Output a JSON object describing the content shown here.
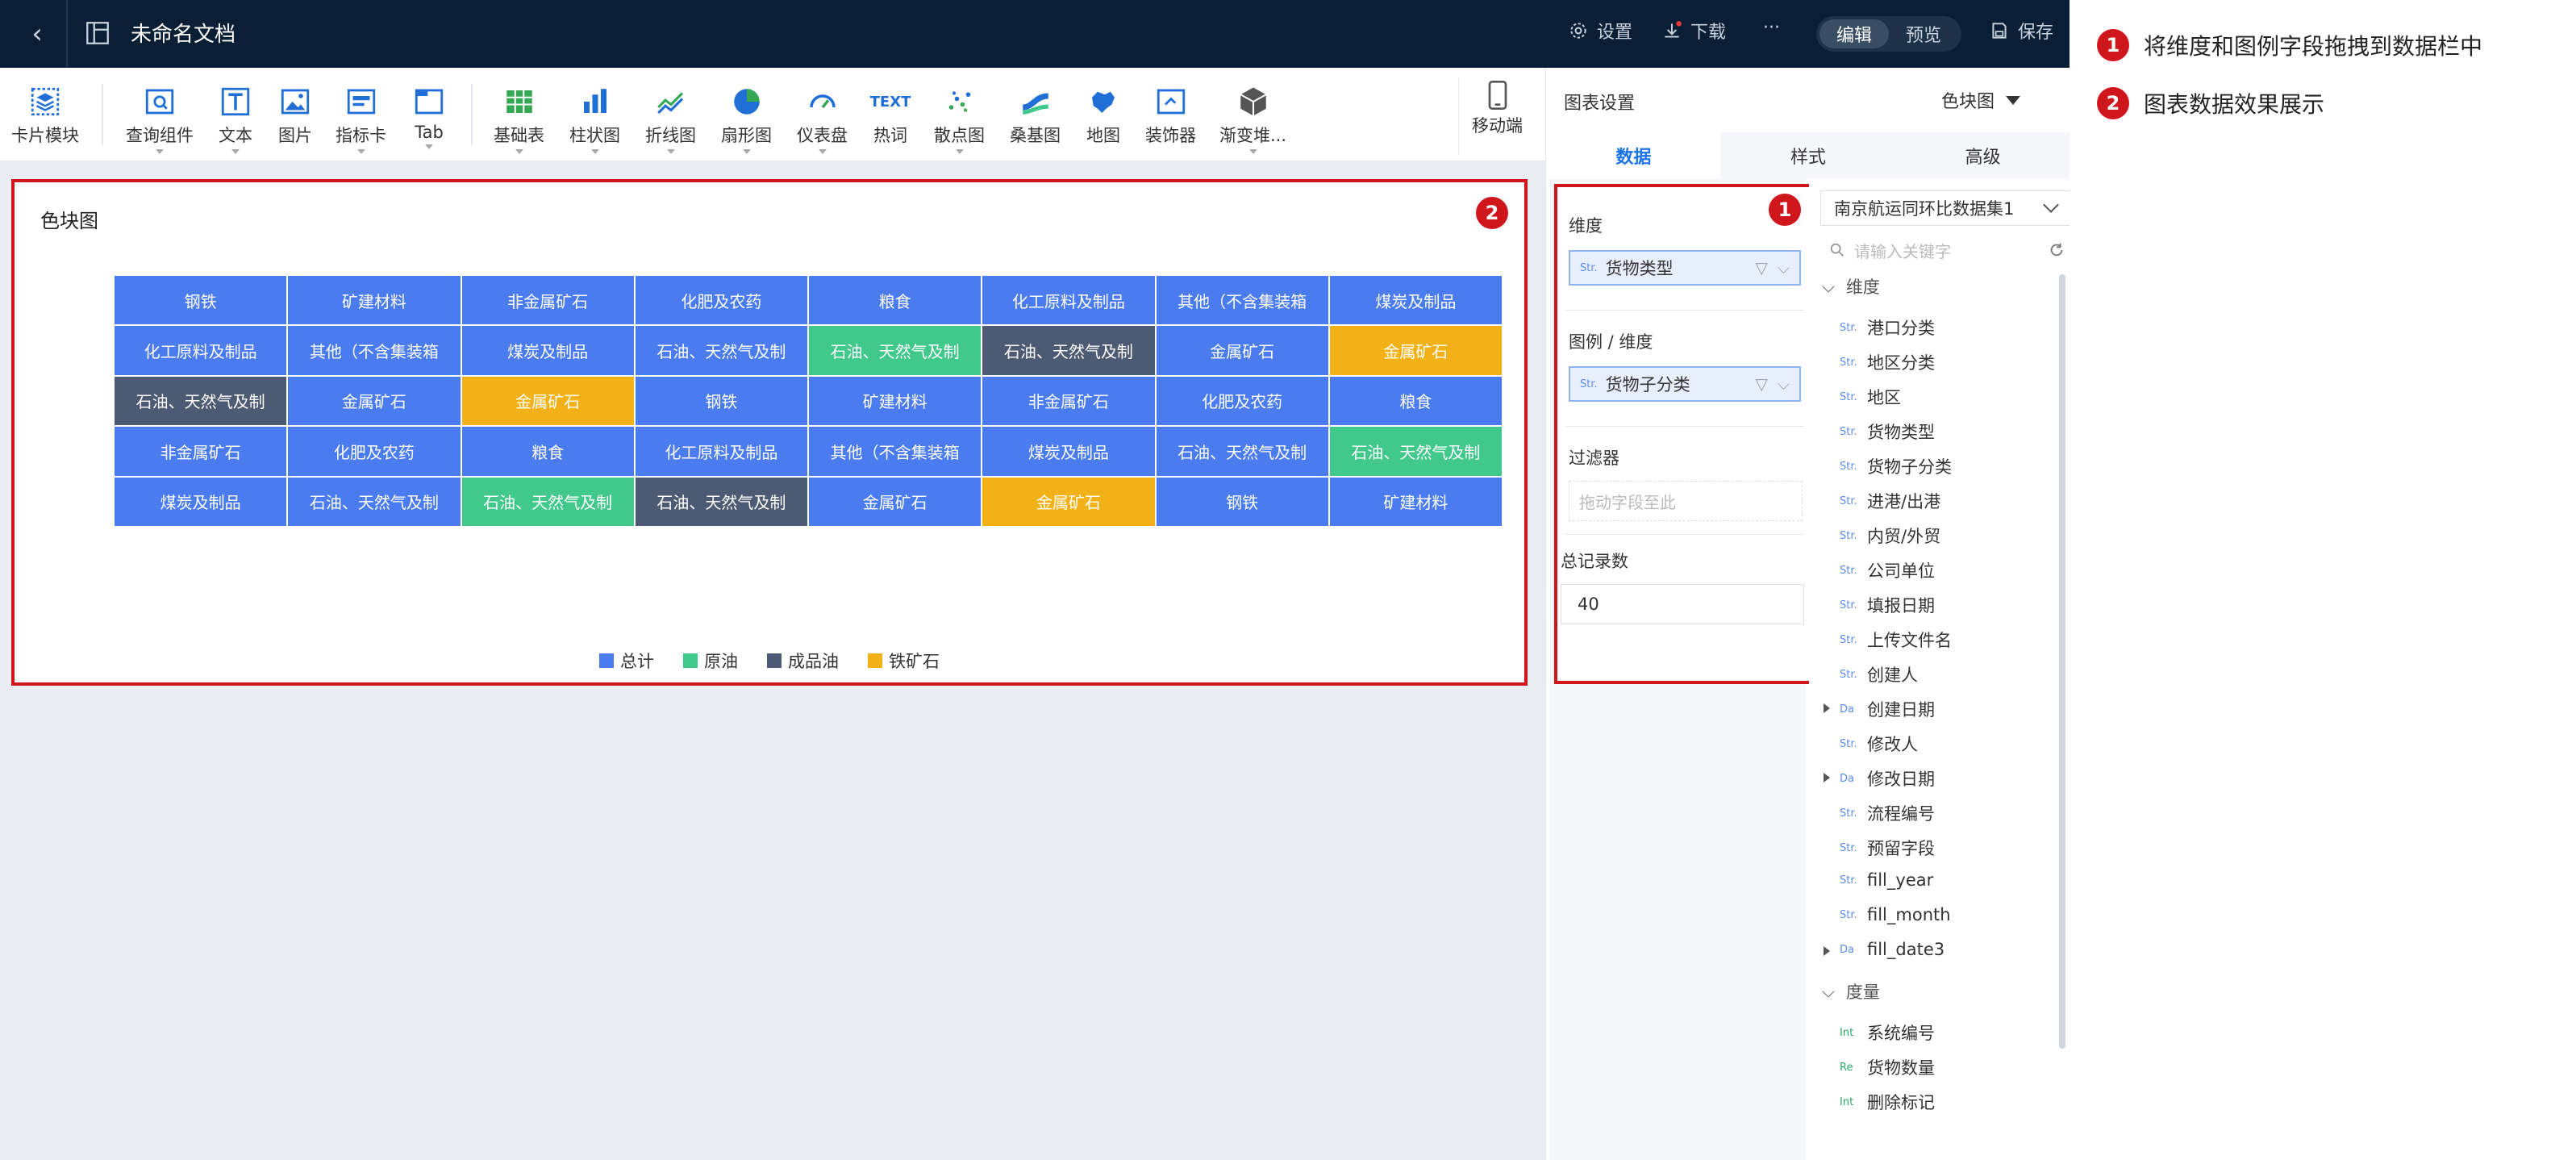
{
  "topbar": {
    "doc_title": "未命名文档",
    "settings": "设置",
    "download": "下载",
    "more": "···",
    "mode_edit": "编辑",
    "mode_preview": "预览",
    "save": "保存"
  },
  "toolbar": {
    "card_module": "卡片模块",
    "query": "查询组件",
    "text": "文本",
    "image": "图片",
    "kpi": "指标卡",
    "tab": "Tab",
    "table": "基础表",
    "bar": "柱状图",
    "line": "折线图",
    "pie": "扇形图",
    "gauge": "仪表盘",
    "wordcloud": "热词",
    "scatter": "散点图",
    "sankey": "桑基图",
    "map": "地图",
    "decorator": "装饰器",
    "gradient": "渐变堆...",
    "mobile": "移动端",
    "wordcloud_icon_text": "TEXT"
  },
  "chart": {
    "title": "色块图",
    "badge": "2"
  },
  "chart_data": {
    "type": "heatmap",
    "title": "色块图",
    "rows": 5,
    "cols": 8,
    "colors": {
      "总计": "#4a7bef",
      "原油": "#40c98b",
      "成品油": "#4d5a73",
      "铁矿石": "#f2b117"
    },
    "legend": [
      "总计",
      "原油",
      "成品油",
      "铁矿石"
    ],
    "legend_position": "bottom",
    "cells": [
      [
        [
          "钢铁",
          "总计"
        ],
        [
          "矿建材料",
          "总计"
        ],
        [
          "非金属矿石",
          "总计"
        ],
        [
          "化肥及农药",
          "总计"
        ],
        [
          "粮食",
          "总计"
        ],
        [
          "化工原料及制品",
          "总计"
        ],
        [
          "其他（不含集装箱",
          "总计"
        ],
        [
          "煤炭及制品",
          "总计"
        ]
      ],
      [
        [
          "化工原料及制品",
          "总计"
        ],
        [
          "其他（不含集装箱",
          "总计"
        ],
        [
          "煤炭及制品",
          "总计"
        ],
        [
          "石油、天然气及制",
          "总计"
        ],
        [
          "石油、天然气及制",
          "原油"
        ],
        [
          "石油、天然气及制",
          "成品油"
        ],
        [
          "金属矿石",
          "总计"
        ],
        [
          "金属矿石",
          "铁矿石"
        ]
      ],
      [
        [
          "石油、天然气及制",
          "成品油"
        ],
        [
          "金属矿石",
          "总计"
        ],
        [
          "金属矿石",
          "铁矿石"
        ],
        [
          "钢铁",
          "总计"
        ],
        [
          "矿建材料",
          "总计"
        ],
        [
          "非金属矿石",
          "总计"
        ],
        [
          "化肥及农药",
          "总计"
        ],
        [
          "粮食",
          "总计"
        ]
      ],
      [
        [
          "非金属矿石",
          "总计"
        ],
        [
          "化肥及农药",
          "总计"
        ],
        [
          "粮食",
          "总计"
        ],
        [
          "化工原料及制品",
          "总计"
        ],
        [
          "其他（不含集装箱",
          "总计"
        ],
        [
          "煤炭及制品",
          "总计"
        ],
        [
          "石油、天然气及制",
          "总计"
        ],
        [
          "石油、天然气及制",
          "原油"
        ]
      ],
      [
        [
          "煤炭及制品",
          "总计"
        ],
        [
          "石油、天然气及制",
          "总计"
        ],
        [
          "石油、天然气及制",
          "原油"
        ],
        [
          "石油、天然气及制",
          "成品油"
        ],
        [
          "金属矿石",
          "总计"
        ],
        [
          "金属矿石",
          "铁矿石"
        ],
        [
          "钢铁",
          "总计"
        ],
        [
          "矿建材料",
          "总计"
        ]
      ]
    ]
  },
  "panel": {
    "title": "图表设置",
    "chart_type": "色块图",
    "tabs": [
      "数据",
      "样式",
      "高级"
    ],
    "badge": "1",
    "dimension_label": "维度",
    "dimension_value": "货物类型",
    "legend_label": "图例 / 维度",
    "legend_value": "货物子分类",
    "filter_label": "过滤器",
    "filter_placeholder": "拖动字段至此",
    "count_label": "总记录数",
    "count_value": "40",
    "str_tag": "Str."
  },
  "dataset": {
    "name": "南京航运同环比数据集1",
    "search_placeholder": "请输入关键字",
    "dim_group": "维度",
    "measure_group": "度量",
    "dims": [
      {
        "tag": "Str.",
        "name": "港口分类"
      },
      {
        "tag": "Str.",
        "name": "地区分类"
      },
      {
        "tag": "Str.",
        "name": "地区"
      },
      {
        "tag": "Str.",
        "name": "货物类型"
      },
      {
        "tag": "Str.",
        "name": "货物子分类"
      },
      {
        "tag": "Str.",
        "name": "进港/出港"
      },
      {
        "tag": "Str.",
        "name": "内贸/外贸"
      },
      {
        "tag": "Str.",
        "name": "公司单位"
      },
      {
        "tag": "Str.",
        "name": "填报日期"
      },
      {
        "tag": "Str.",
        "name": "上传文件名"
      },
      {
        "tag": "Str.",
        "name": "创建人"
      },
      {
        "tag": "Da",
        "name": "创建日期",
        "expandable": true
      },
      {
        "tag": "Str.",
        "name": "修改人"
      },
      {
        "tag": "Da",
        "name": "修改日期",
        "expandable": true
      },
      {
        "tag": "Str.",
        "name": "流程编号"
      },
      {
        "tag": "Str.",
        "name": "预留字段"
      },
      {
        "tag": "Str.",
        "name": "fill_year"
      },
      {
        "tag": "Str.",
        "name": "fill_month"
      },
      {
        "tag": "Da",
        "name": "fill_date3",
        "expandable": true
      }
    ],
    "measures": [
      {
        "tag": "Int",
        "name": "系统编号"
      },
      {
        "tag": "Re",
        "name": "货物数量"
      },
      {
        "tag": "Int",
        "name": "删除标记"
      }
    ]
  },
  "notes": [
    {
      "num": "1",
      "text": "将维度和图例字段拖拽到数据栏中"
    },
    {
      "num": "2",
      "text": "图表数据效果展示"
    }
  ],
  "accent": "#d0161d"
}
